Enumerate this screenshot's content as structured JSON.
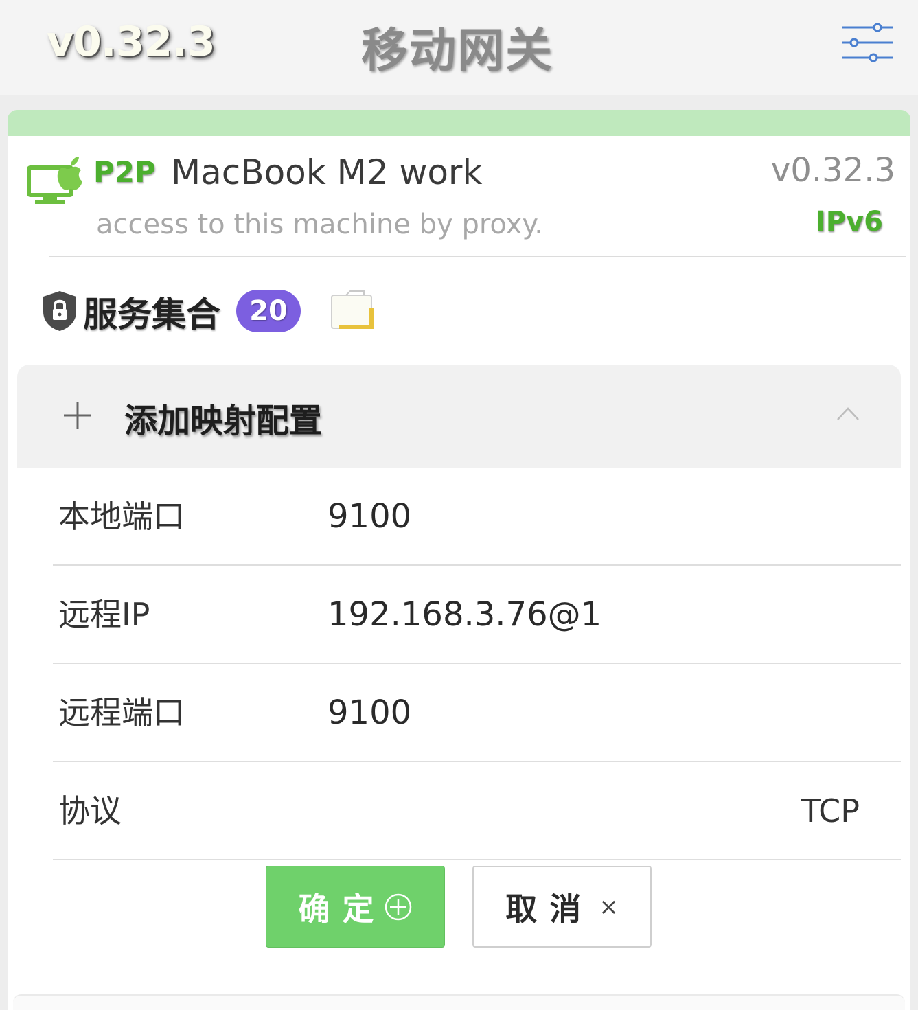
{
  "header": {
    "version": "v0.32.3",
    "title": "移动网关",
    "filter_icon": "sliders-icon"
  },
  "node": {
    "type": "P2P",
    "name": "MacBook M2 work",
    "version": "v0.32.3",
    "description": "access to this machine by proxy.",
    "ip_type": "IPv6",
    "icon": "mac-monitor-icon",
    "accent_color": "#4caf2f"
  },
  "services": {
    "label": "服务集合",
    "count": "20",
    "badge_color": "#7c5fe0"
  },
  "add_mapping": {
    "label": "添加映射配置",
    "expanded": true
  },
  "form": {
    "local_port_label": "本地端口",
    "local_port_value": "9100",
    "remote_ip_label": "远程IP",
    "remote_ip_value": "192.168.3.76@1",
    "remote_port_label": "远程端口",
    "remote_port_value": "9100",
    "protocol_label": "协议",
    "protocol_value": "TCP"
  },
  "buttons": {
    "confirm": "确定",
    "cancel": "取消",
    "cancel_x": "×",
    "confirm_color": "#6fd16b"
  }
}
